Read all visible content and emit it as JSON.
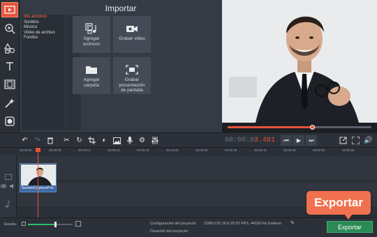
{
  "accent_color": "#e5533b",
  "export_color": "#2a8a55",
  "left_tools": [
    {
      "icon": "import-media-icon",
      "active": true
    },
    {
      "icon": "magic-wand-icon"
    },
    {
      "icon": "shapes-icon"
    },
    {
      "icon": "text-icon"
    },
    {
      "icon": "film-strip-icon"
    },
    {
      "icon": "wand-sparkle-icon"
    },
    {
      "icon": "stickers-icon"
    }
  ],
  "import": {
    "title": "Importar",
    "categories": [
      "Mis archivos",
      "Sonidos",
      "Música",
      "Video de archivo",
      "Fondos"
    ],
    "selected_category": "Mis archivos",
    "tiles": [
      {
        "label": "Agregar\narchivos",
        "icon": "add-files-icon"
      },
      {
        "label": "Grabar video",
        "icon": "camera-icon"
      },
      {
        "label": "Agregar\ncarpeta",
        "icon": "folder-icon"
      },
      {
        "label": "Grabar\npresentación\nde pantalla",
        "icon": "screen-record-icon"
      }
    ]
  },
  "preview": {
    "progress": 0.59
  },
  "edit_toolbar": {
    "timecode_main": "00:00:0",
    "timecode_ms": "3.481",
    "tools": [
      "undo-icon",
      "redo-icon",
      "delete-icon",
      "cut-icon",
      "rotate-icon",
      "crop-icon",
      "color-adjust-icon",
      "image-icon",
      "microphone-icon",
      "gear-icon",
      "equalizer-icon"
    ],
    "playback": [
      "skip-back-icon",
      "play-icon",
      "skip-forward-icon"
    ],
    "right": [
      "detach-icon",
      "fullscreen-icon",
      "volume-icon"
    ]
  },
  "ruler": [
    "00:00:00",
    "00:00:05",
    "00:00:10",
    "00:00:15",
    "00:00:20",
    "00:00:25",
    "00:00:30",
    "00:00:35",
    "00:00:40",
    "00:00:45",
    "00:00:50",
    "00:00:55"
  ],
  "clip": {
    "label": "ScreenCapturePro"
  },
  "bottom": {
    "zoom_label": "Escala:",
    "zoom_level": 0.62,
    "config_label": "Configuración del proyecto:",
    "config_value": "1280x720 16:9 29.97 FPS, 44100 Hz Estéreo",
    "duration_label": "Duración del proyecto:",
    "export_label": "Exportar"
  },
  "callout": {
    "text": "Exportar"
  }
}
